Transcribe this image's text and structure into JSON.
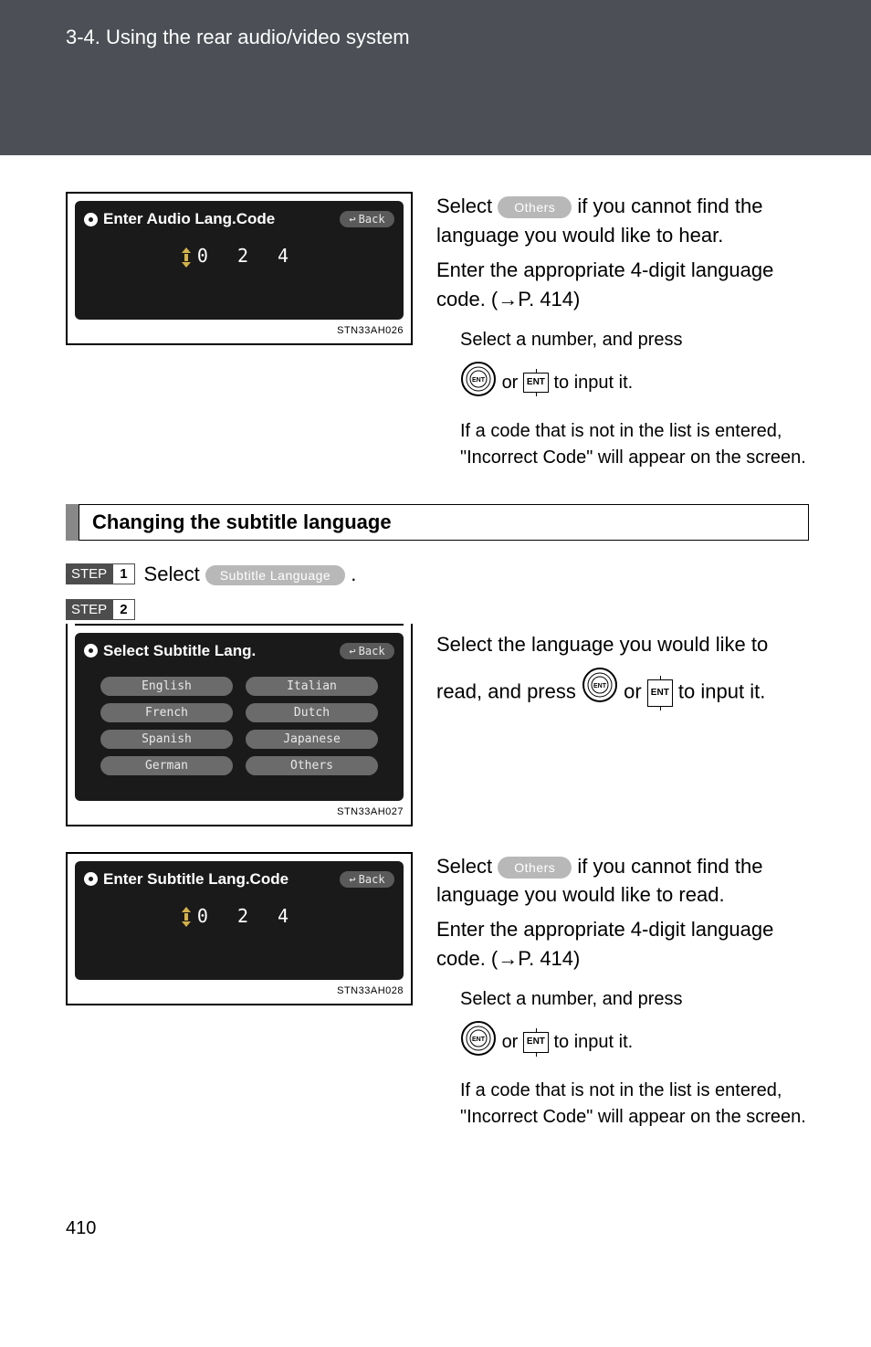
{
  "header": {
    "breadcrumb": "3-4. Using the rear audio/video system"
  },
  "panels": {
    "audio_code": {
      "title": "Enter Audio Lang.Code",
      "back_label": "Back",
      "digits": "0 2 4",
      "img_id": "STN33AH026"
    },
    "subtitle_select": {
      "title": "Select Subtitle Lang.",
      "back_label": "Back",
      "options": [
        "English",
        "Italian",
        "French",
        "Dutch",
        "Spanish",
        "Japanese",
        "German",
        "Others"
      ],
      "img_id": "STN33AH027"
    },
    "subtitle_code": {
      "title": "Enter Subtitle Lang.Code",
      "back_label": "Back",
      "digits": "0 2 4",
      "img_id": "STN33AH028"
    }
  },
  "text": {
    "block1": {
      "p1a": "Select ",
      "others_pill": "Others",
      "p1b": " if you cannot find the language you would like to hear.",
      "p2": "Enter the appropriate 4-digit language code. (→P. 414)",
      "sub1": "Select a number, and press",
      "sub2a": " or ",
      "sub2b": " to input it.",
      "sub3": "If a code that is not in the list is entered, \"Incorrect Code\" will appear on the screen."
    },
    "section_title": "Changing the subtitle language",
    "step1": {
      "label": "STEP",
      "num": "1",
      "text_a": "Select ",
      "pill": "Subtitle Language",
      "text_b": "."
    },
    "step2": {
      "label": "STEP",
      "num": "2"
    },
    "block2": {
      "p1": "Select the language you would like to read, and press ",
      "or": " or ",
      "p2": " to input it."
    },
    "block3": {
      "p1a": "Select ",
      "others_pill": "Others",
      "p1b": " if you cannot find the language you would like to read.",
      "p2": "Enter the appropriate 4-digit language code. (→P. 414)",
      "sub1": "Select a number, and press",
      "sub2a": " or ",
      "sub2b": " to input it.",
      "sub3": "If a code that is not in the list is entered, \"Incorrect Code\" will appear on the screen."
    }
  },
  "footer": {
    "page_number": "410"
  },
  "icons": {
    "ent": "ENT"
  }
}
